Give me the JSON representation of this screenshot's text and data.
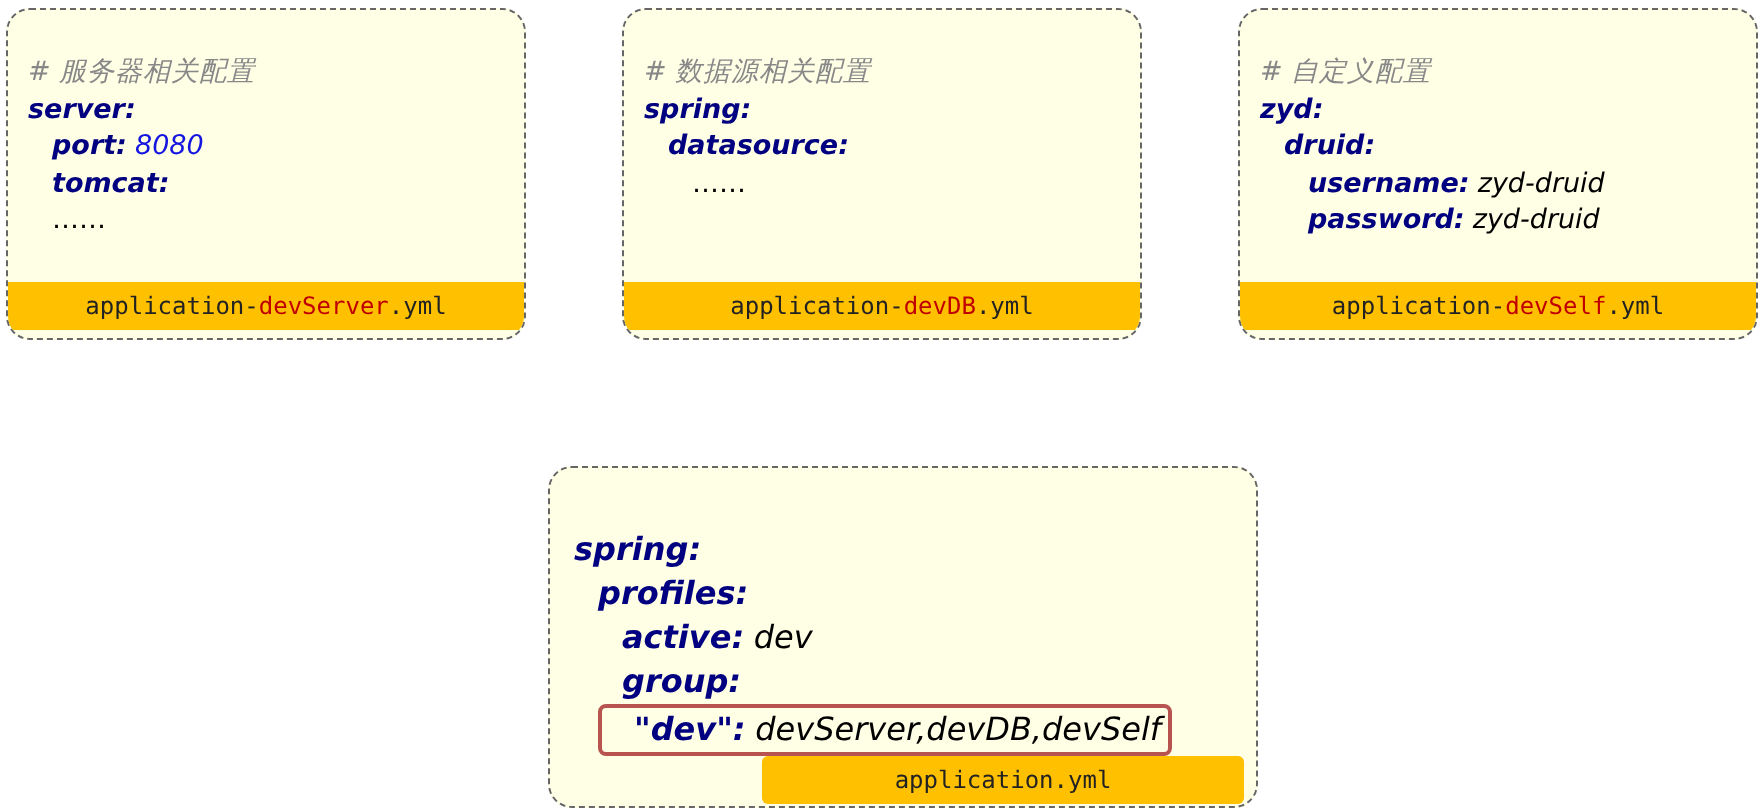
{
  "cards": [
    {
      "kind": "profile",
      "filename": [
        {
          "text": "application-",
          "highlight": false
        },
        {
          "text": "devServer",
          "highlight": true
        },
        {
          "text": ".yml",
          "highlight": false
        }
      ],
      "lines": [
        {
          "kind": "comment",
          "text": "# 服务器相关配置"
        },
        {
          "kind": "key",
          "key": "server:",
          "children": [
            {
              "kind": "number-pair",
              "key": "port:",
              "value": "8080"
            },
            {
              "kind": "key",
              "key": "tomcat:"
            },
            {
              "kind": "ellipsis",
              "text": "……"
            }
          ]
        }
      ]
    },
    {
      "kind": "profile",
      "filename": [
        {
          "text": "application-",
          "highlight": false
        },
        {
          "text": "devDB",
          "highlight": true
        },
        {
          "text": ".yml",
          "highlight": false
        }
      ],
      "lines": [
        {
          "kind": "comment",
          "text": "# 数据源相关配置"
        },
        {
          "kind": "key",
          "key": "spring:",
          "children": [
            {
              "kind": "key",
              "key": "datasource:",
              "children": [
                {
                  "kind": "ellipsis",
                  "text": "……"
                }
              ]
            }
          ]
        }
      ]
    },
    {
      "kind": "profile",
      "filename": [
        {
          "text": "application-",
          "highlight": false
        },
        {
          "text": "devSelf",
          "highlight": true
        },
        {
          "text": ".yml",
          "highlight": false
        }
      ],
      "lines": [
        {
          "kind": "comment",
          "text": "# 自定义配置"
        },
        {
          "kind": "key",
          "key": "zyd:",
          "children": [
            {
              "kind": "key",
              "key": "druid:",
              "children": [
                {
                  "kind": "pair",
                  "key": "username:",
                  "value": "zyd-druid"
                },
                {
                  "kind": "pair",
                  "key": "password:",
                  "value": "zyd-druid"
                }
              ]
            }
          ]
        }
      ]
    },
    {
      "kind": "main",
      "filename": [
        {
          "text": "application.yml",
          "highlight": false
        }
      ],
      "lines": [
        {
          "kind": "key",
          "key": "spring:",
          "children": [
            {
              "kind": "key",
              "key": "profiles:",
              "children": [
                {
                  "kind": "pair",
                  "key": "active:",
                  "value": "dev"
                },
                {
                  "kind": "key",
                  "key": "group:",
                  "children": [
                    {
                      "kind": "pair",
                      "key": "\"dev\":",
                      "value": "devServer,devDB,devSelf",
                      "highlighted": true
                    }
                  ]
                }
              ]
            }
          ]
        }
      ]
    }
  ]
}
